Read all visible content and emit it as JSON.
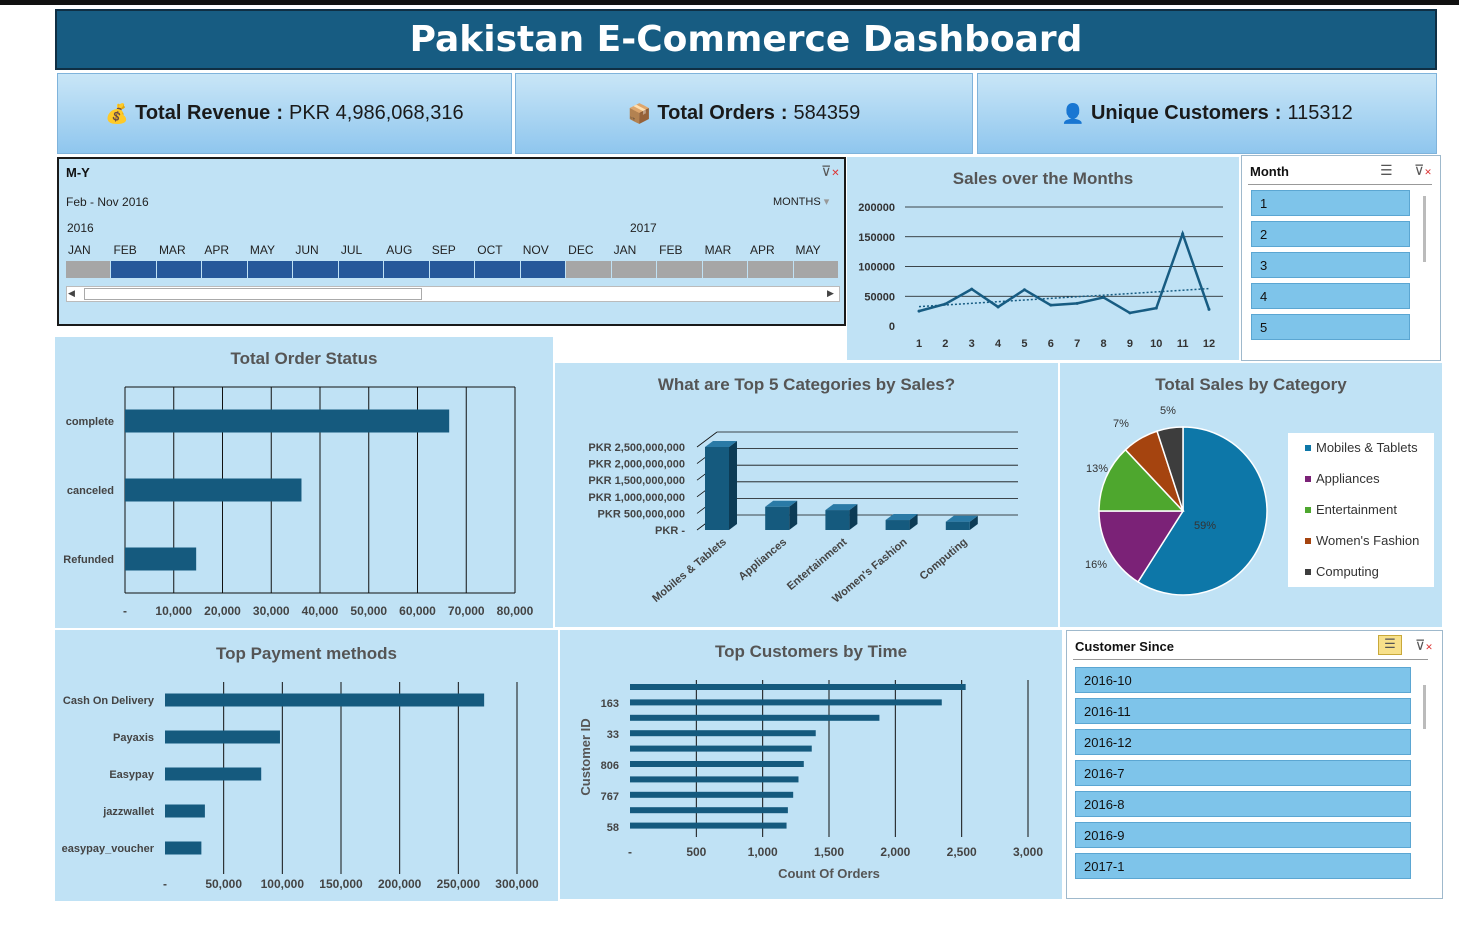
{
  "dashboard": {
    "title": "Pakistan E-Commerce Dashboard",
    "kpis": [
      {
        "icon": "money-bag-icon",
        "label": "Total Revenue",
        "value": "PKR 4,986,068,316"
      },
      {
        "icon": "package-icon",
        "label": "Total Orders",
        "value": "584359"
      },
      {
        "icon": "user-icon",
        "label": "Unique Customers",
        "value": "115312"
      }
    ],
    "colors": {
      "header": "#175c82",
      "bar": "#155a7e",
      "panel": "#c0e2f5",
      "slicer_item": "#7ec4ea",
      "timeline_selected": "#26589a",
      "timeline_unselected": "#a6a6a6"
    }
  },
  "timeline": {
    "title": "M-Y",
    "range_label": "Feb - Nov 2016",
    "level": "MONTHS",
    "year_2016": "2016",
    "year_2017": "2017",
    "months": [
      "JAN",
      "FEB",
      "MAR",
      "APR",
      "MAY",
      "JUN",
      "JUL",
      "AUG",
      "SEP",
      "OCT",
      "NOV",
      "DEC",
      "JAN",
      "FEB",
      "MAR",
      "APR",
      "MAY"
    ],
    "selected": [
      false,
      true,
      true,
      true,
      true,
      true,
      true,
      true,
      true,
      true,
      true,
      false,
      false,
      false,
      false,
      false,
      false
    ]
  },
  "month_slicer": {
    "title": "Month",
    "items": [
      "1",
      "2",
      "3",
      "4",
      "5"
    ]
  },
  "customer_slicer": {
    "title": "Customer Since",
    "items": [
      "2016-10",
      "2016-11",
      "2016-12",
      "2016-7",
      "2016-8",
      "2016-9",
      "2017-1"
    ]
  },
  "chart_data": [
    {
      "type": "line",
      "title": "Sales over the Months",
      "x": [
        1,
        2,
        3,
        4,
        5,
        6,
        7,
        8,
        9,
        10,
        11,
        12
      ],
      "y": [
        25000,
        37000,
        62000,
        32000,
        61000,
        35000,
        38000,
        48000,
        22000,
        30000,
        155000,
        28000
      ],
      "ylim": [
        0,
        200000
      ],
      "yticks": [
        "0",
        "50000",
        "100000",
        "150000",
        "200000"
      ],
      "trendline": "linear",
      "grid": true
    },
    {
      "type": "bar",
      "orientation": "horizontal",
      "title": "Total Order Status",
      "categories": [
        "complete",
        "canceled",
        "Refunded"
      ],
      "values": [
        66500,
        36200,
        14600
      ],
      "xlim": [
        0,
        80000
      ],
      "xticks": [
        "-",
        "10,000",
        "20,000",
        "30,000",
        "40,000",
        "50,000",
        "60,000",
        "70,000",
        "80,000"
      ],
      "grid": true
    },
    {
      "type": "bar",
      "title": "What are Top 5 Categories by Sales?",
      "categories": [
        "Mobiles & Tablets",
        "Appliances",
        "Entertainment",
        "Women's Fashion",
        "Computing"
      ],
      "values": [
        2500000000,
        700000000,
        600000000,
        300000000,
        250000000
      ],
      "ylim": [
        0,
        2500000000
      ],
      "yticks": [
        "PKR -",
        "PKR 500,000,000",
        "PKR 1,000,000,000",
        "PKR 1,500,000,000",
        "PKR 2,000,000,000",
        "PKR 2,500,000,000"
      ],
      "style": "3d"
    },
    {
      "type": "pie",
      "title": "Total Sales by Category",
      "labels": [
        "Mobiles & Tablets",
        "Appliances",
        "Entertainment",
        "Women's Fashion",
        "Computing"
      ],
      "values": [
        59,
        16,
        13,
        7,
        5
      ],
      "value_labels": [
        "59%",
        "16%",
        "13%",
        "7%",
        "5%"
      ],
      "colors": [
        "#0d77a8",
        "#7b2277",
        "#4ea72e",
        "#a5440f",
        "#3d3d3d"
      ],
      "legend": "right"
    },
    {
      "type": "bar",
      "orientation": "horizontal",
      "title": "Top Payment methods",
      "categories": [
        "Cash On Delivery",
        "Payaxis",
        "Easypay",
        "jazzwallet",
        "easypay_voucher"
      ],
      "values": [
        272000,
        98000,
        82000,
        34000,
        31000
      ],
      "xlim": [
        0,
        300000
      ],
      "xticks": [
        "-",
        "50,000",
        "100,000",
        "150,000",
        "200,000",
        "250,000",
        "300,000"
      ],
      "grid": true
    },
    {
      "type": "bar",
      "orientation": "horizontal",
      "title": "Top Customers by Time",
      "xlabel": "Count Of Orders",
      "ylabel": "Customer ID",
      "ytick_labels": [
        "163",
        "33",
        "806",
        "767",
        "58"
      ],
      "values": [
        2530,
        2350,
        1880,
        1400,
        1370,
        1310,
        1270,
        1230,
        1190,
        1180
      ],
      "xlim": [
        0,
        3000
      ],
      "xticks": [
        "-",
        "500",
        "1,000",
        "1,500",
        "2,000",
        "2,500",
        "3,000"
      ],
      "grid": true
    }
  ]
}
